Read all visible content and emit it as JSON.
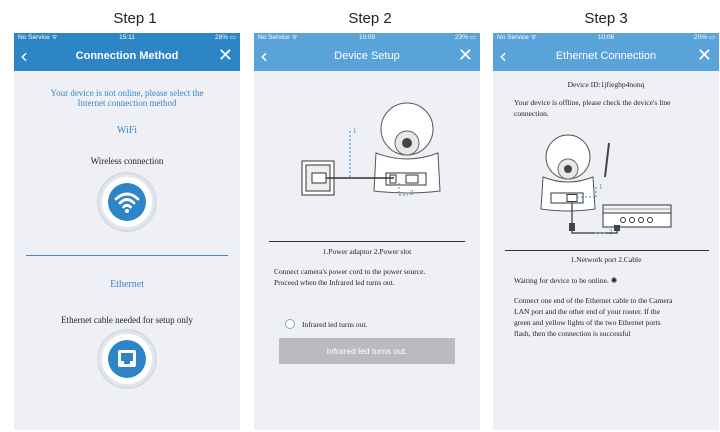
{
  "steps": [
    "Step 1",
    "Step 2",
    "Step 3"
  ],
  "phone1": {
    "status": {
      "carrier": "No Service",
      "time": "15:11",
      "battery": "28%"
    },
    "title": "Connection Method",
    "notice_line1": "Your device is not online, please select the",
    "notice_line2": "Internet connection method",
    "wifi_heading": "WiFi",
    "wifi_caption": "Wireless connection",
    "ethernet_heading": "Ethernet",
    "ethernet_caption": "Ethernet cable needed for setup only",
    "accent": "#2e85c6"
  },
  "phone2": {
    "status": {
      "carrier": "No Service",
      "time": "10:09",
      "battery": "23%"
    },
    "title": "Device Setup",
    "callout_1": "1",
    "callout_2": "2",
    "diagram_caption": "1.Power adaptor 2.Power slot",
    "instruction_line1": "Connect camera's power cord to the power source.",
    "instruction_line2": "Proceed when the Infrared led turns out.",
    "checkbox_label": "Infrared led turns out.",
    "button_label": "Infrared led turns out."
  },
  "phone3": {
    "status": {
      "carrier": "No Service",
      "time": "10:06",
      "battery": "20%"
    },
    "title": "Ethernet Connection",
    "device_id": "Device ID:1jfiegbp4nonq",
    "offline_line1": "Your device is offline, please check the device's line",
    "offline_line2": "connection.",
    "callout_1": "1",
    "callout_2": "2",
    "diagram_caption": "1.Network port 2.Cable",
    "waiting": "Waiting for device to be online.",
    "instr_line1": "Connect one end of the Ethernet cable to the Camera",
    "instr_line2": "LAN port and the other end of your router. If the",
    "instr_line3": "green and yellow lights of the two Ethernet ports",
    "instr_line4": "flash, then the connection is successful"
  }
}
